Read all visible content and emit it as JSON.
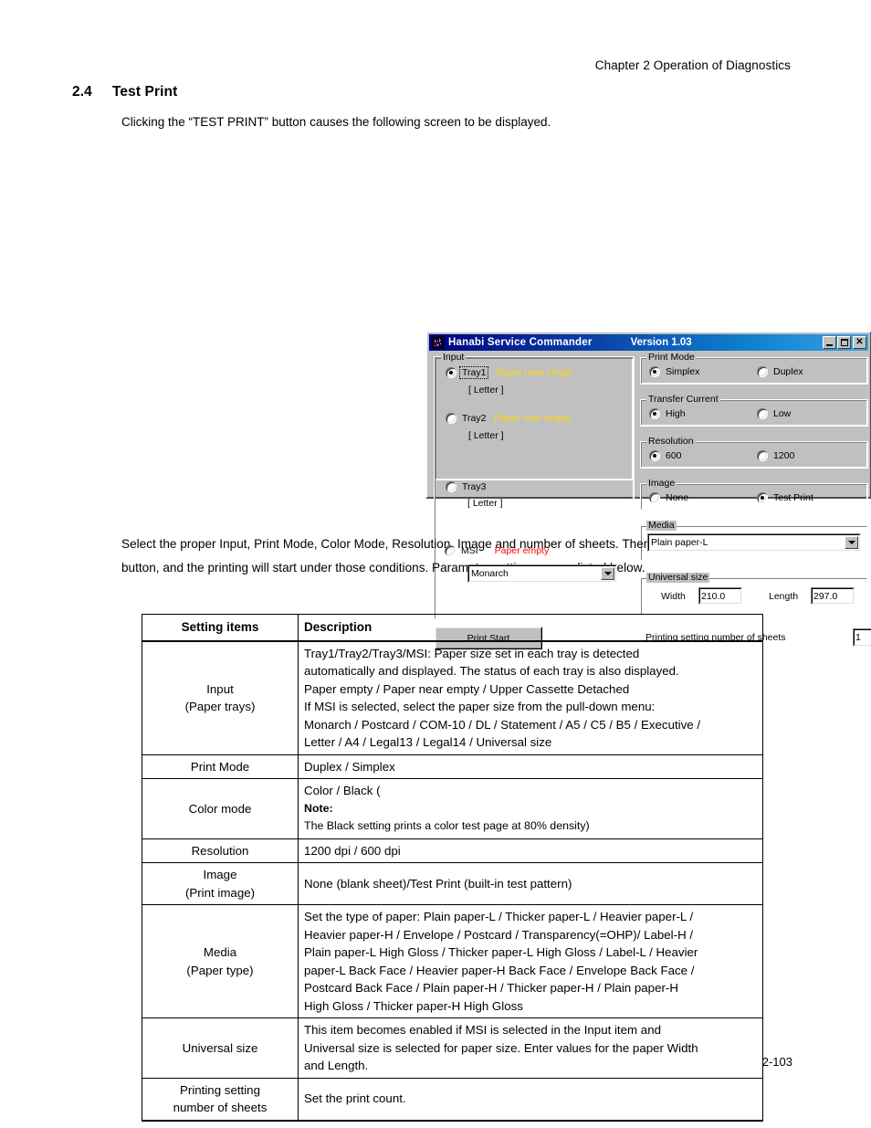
{
  "page": {
    "header": "Chapter 2  Operation of Diagnostics",
    "section_number": "2.4",
    "section_title": "Test Print",
    "intro": "Clicking the “TEST PRINT” button causes the following screen to be displayed.",
    "paragraph": "Select the proper Input, Print Mode, Color Mode, Resolution, Image and number of sheets. Then click the “Print Start” button, and the printing will start under those conditions. Parameter settings are as listed below.",
    "page_number": "2-103"
  },
  "dialog": {
    "title": "Hanabi Service Commander",
    "version": "Version 1.03",
    "icon": "app-icon",
    "window_buttons": {
      "minimize": "_",
      "maximize": "□",
      "close": "✕"
    },
    "input_group": {
      "legend": "Input",
      "trays": [
        {
          "label": "Tray1",
          "selected": true,
          "focused": true,
          "status": "Paper near empty",
          "status_color": "#ffd900",
          "paper_size": "[ Letter ]"
        },
        {
          "label": "Tray2",
          "selected": false,
          "focused": false,
          "status": "Paper near empty",
          "status_color": "#ffd900",
          "paper_size": "[ Letter ]"
        },
        {
          "label": "Tray3",
          "selected": false,
          "focused": false,
          "status": "",
          "status_color": "",
          "paper_size": "[ Letter ]"
        },
        {
          "label": "MSI",
          "selected": false,
          "focused": false,
          "status": "Paper empty",
          "status_color": "#ff0000",
          "paper_size": ""
        }
      ],
      "msi_size_value": "Monarch"
    },
    "print_mode_group": {
      "legend": "Print Mode",
      "options": [
        {
          "label": "Simplex",
          "selected": true
        },
        {
          "label": "Duplex",
          "selected": false
        }
      ]
    },
    "transfer_current_group": {
      "legend": "Transfer Current",
      "options": [
        {
          "label": "High",
          "selected": true
        },
        {
          "label": "Low",
          "selected": false
        }
      ]
    },
    "resolution_group": {
      "legend": "Resolution",
      "options": [
        {
          "label": "600",
          "selected": true
        },
        {
          "label": "1200",
          "selected": false
        }
      ]
    },
    "image_group": {
      "legend": "Image",
      "options": [
        {
          "label": "None",
          "selected": false
        },
        {
          "label": "Test Print",
          "selected": true
        }
      ]
    },
    "media_group": {
      "legend": "Media",
      "value": "Plain paper-L"
    },
    "universal_size_group": {
      "legend": "Universal size",
      "width_label": "Width",
      "width_value": "210.0",
      "length_label": "Length",
      "length_value": "297.0"
    },
    "print_start_button": "Print Start",
    "sheets_label": "Printing setting number of sheets",
    "sheets_value": "1"
  },
  "table": {
    "headers": {
      "item": "Setting items",
      "description": "Description"
    },
    "rows": [
      {
        "item_lines": [
          "Input",
          "(Paper trays)"
        ],
        "desc_lines": [
          "Tray1/Tray2/Tray3/MSI: Paper size set in each tray is detected",
          "automatically and displayed. The status of each tray is also displayed.",
          "Paper empty / Paper near empty / Upper Cassette Detached",
          "If MSI is selected, select the paper size from the pull-down menu:",
          "Monarch / Postcard / COM-10 / DL / Statement / A5 / C5 / B5 / Executive /",
          "Letter / A4 / Legal13 / Legal14 / Universal size"
        ]
      },
      {
        "item_lines": [
          "Print Mode"
        ],
        "desc_lines": [
          "Duplex / Simplex"
        ]
      },
      {
        "item_lines": [
          "Color mode"
        ],
        "desc_prefix": "Color / Black (",
        "desc_note_bold": "Note:",
        "desc_suffix": " The Black setting prints a color test page at 80% density)"
      },
      {
        "item_lines": [
          "Resolution"
        ],
        "desc_lines": [
          "1200 dpi / 600 dpi"
        ]
      },
      {
        "item_lines": [
          "Image",
          "(Print image)"
        ],
        "desc_lines": [
          "None (blank sheet)/Test Print (built-in test pattern)"
        ]
      },
      {
        "item_lines": [
          "Media",
          "(Paper type)"
        ],
        "desc_lines": [
          "Set the type of paper: Plain paper-L / Thicker paper-L / Heavier paper-L /",
          "Heavier paper-H / Envelope / Postcard / Transparency(=OHP)/ Label-H /",
          "Plain paper-L High Gloss / Thicker paper-L High Gloss / Label-L / Heavier",
          "paper-L Back Face / Heavier paper-H Back Face / Envelope Back Face /",
          "Postcard Back Face / Plain paper-H / Thicker paper-H / Plain paper-H",
          "High Gloss / Thicker paper-H High Gloss"
        ]
      },
      {
        "item_lines": [
          "Universal size"
        ],
        "desc_lines": [
          "This item becomes enabled if MSI is selected in the Input item and",
          "Universal size is selected for paper size. Enter values for the paper Width",
          "and Length."
        ]
      },
      {
        "item_lines": [
          "Printing setting",
          "number of sheets"
        ],
        "desc_lines": [
          "Set the print count."
        ]
      }
    ]
  }
}
